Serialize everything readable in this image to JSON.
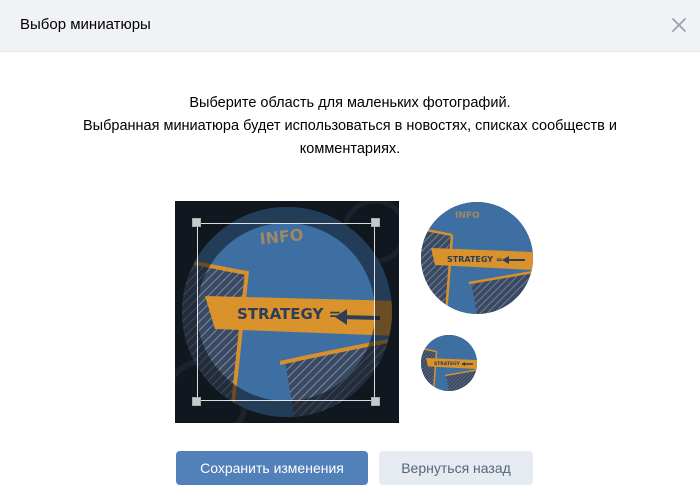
{
  "dialog": {
    "title": "Выбор миниатюры",
    "close_icon": "close-icon"
  },
  "instructions": {
    "line1": "Выберите область для маленьких фотографий.",
    "line2": "Выбранная миниатюра будет использоваться в новостях, списках сообществ и",
    "line3": "комментариях."
  },
  "image": {
    "stamp_text_top": "INFO",
    "label_text": "STRATEGY ="
  },
  "buttons": {
    "save_label": "Сохранить изменения",
    "back_label": "Вернуться назад"
  },
  "colors": {
    "primary_button": "#5181b8",
    "secondary_button": "#e5ebf1",
    "header_bg": "#f0f2f5"
  }
}
